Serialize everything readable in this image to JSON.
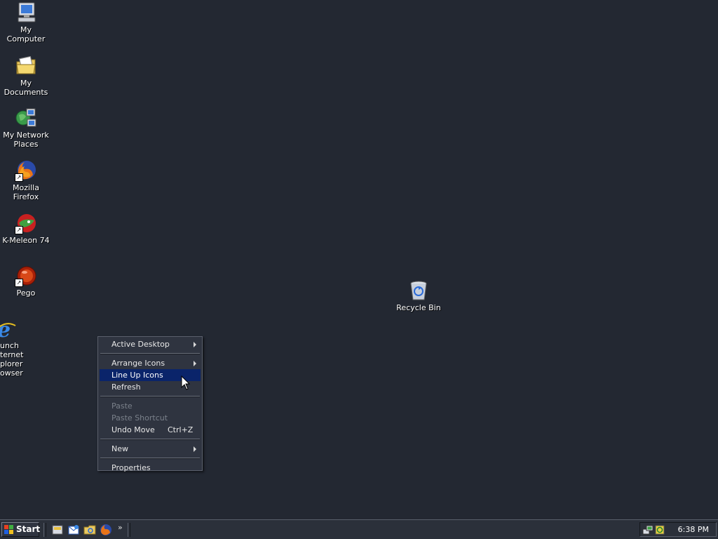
{
  "desktop": {
    "icons": [
      {
        "label": "My Computer"
      },
      {
        "label": "My Documents"
      },
      {
        "label": "My Network Places"
      },
      {
        "label": "Mozilla Firefox"
      },
      {
        "label": "K-Meleon 74"
      },
      {
        "label": "Pego"
      },
      {
        "label": "unch ternet plorer owser"
      },
      {
        "label": "Recycle Bin"
      }
    ]
  },
  "context_menu": {
    "items": [
      {
        "label": "Active Desktop",
        "submenu": true
      },
      {
        "label": "Arrange Icons",
        "submenu": true
      },
      {
        "label": "Line Up Icons",
        "selected": true
      },
      {
        "label": "Refresh"
      },
      {
        "label": "Paste",
        "disabled": true
      },
      {
        "label": "Paste Shortcut",
        "disabled": true
      },
      {
        "label": "Undo Move",
        "shortcut": "Ctrl+Z"
      },
      {
        "label": "New",
        "submenu": true
      },
      {
        "label": "Properties"
      }
    ]
  },
  "taskbar": {
    "start_label": "Start",
    "quick_launch_more": "»",
    "clock": "6:38 PM"
  },
  "colors": {
    "desktop_bg": "#232832",
    "menu_bg": "#2f3440",
    "menu_highlight": "#0a246a",
    "taskbar_bg": "#2b303a"
  }
}
